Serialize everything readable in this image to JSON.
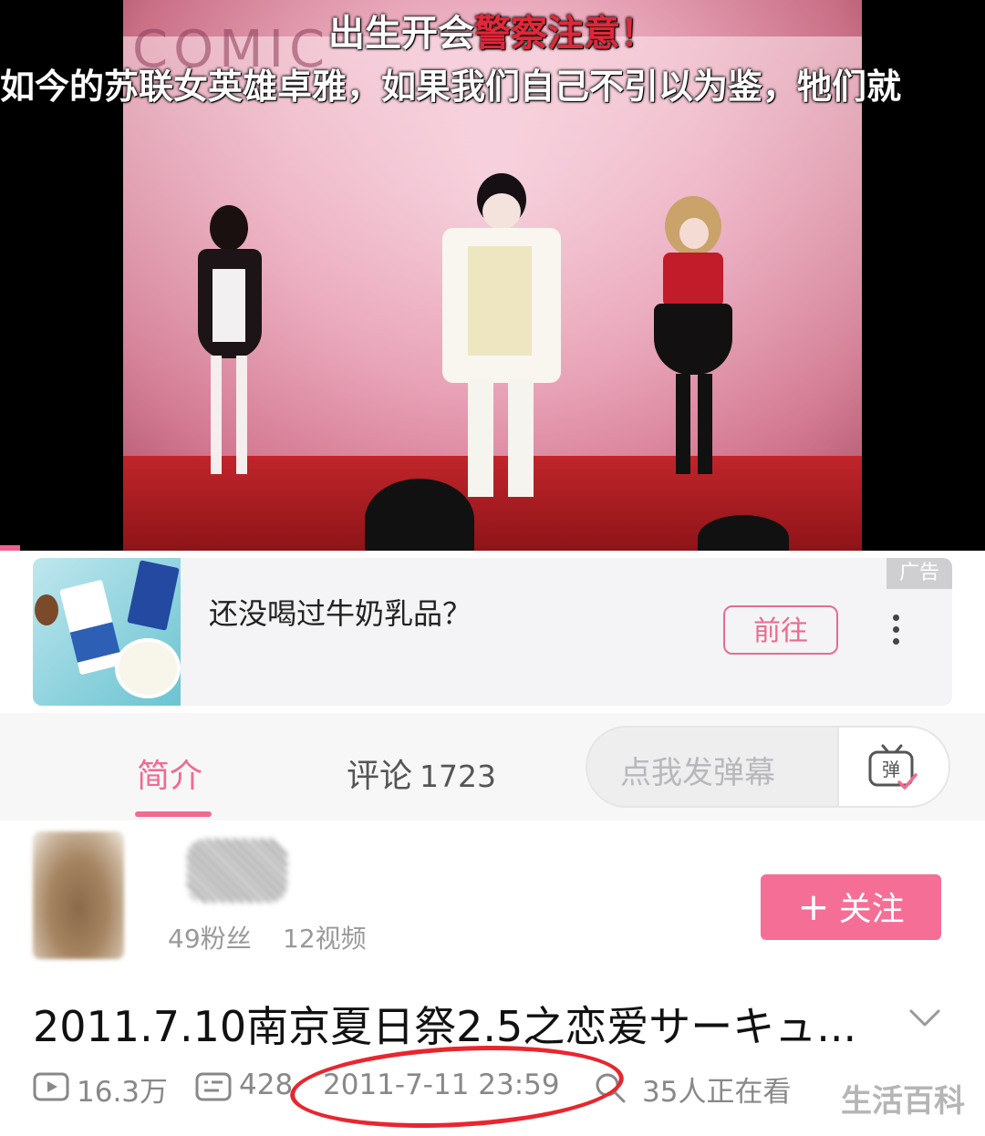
{
  "video": {
    "banner_text": "COMIC",
    "subtitle_line1_white": "出生开会",
    "subtitle_line1_red": "警察注意！",
    "subtitle_line2": "如今的苏联女英雄卓雅，如果我们自己不引以为鉴，牠们就"
  },
  "ad": {
    "title": "还没喝过牛奶乳品？",
    "badge": "广告",
    "button_label": "前往"
  },
  "tabs": {
    "intro_label": "简介",
    "comments_label": "评论",
    "comments_count": "1723"
  },
  "danmaku": {
    "placeholder": "点我发弹幕",
    "icon_label": "弹"
  },
  "uploader": {
    "fans": "49粉丝",
    "videos": "12视频",
    "follow_label": "关注",
    "follow_icon": "+"
  },
  "video_info": {
    "title": "2011.7.10南京夏日祭2.5之恋爱サーキュ...",
    "views": "16.3万",
    "danmaku_count": "428",
    "publish_time": "2011-7-11 23:59",
    "watching_now": "35人正在看"
  },
  "watermark": "生活百科",
  "colors": {
    "accent": "#f06b8f",
    "follow_button": "#f46e96",
    "annotation_circle": "#e8262e"
  }
}
